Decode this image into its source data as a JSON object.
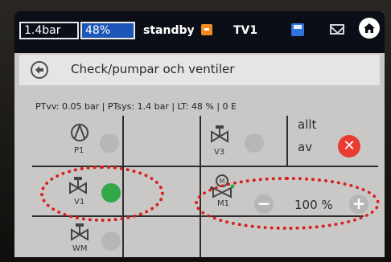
{
  "topbar": {
    "pressure": "1.4bar",
    "percent": "48%",
    "mode": "standby",
    "zone": "TV1"
  },
  "header": {
    "title": "Check/pumpar och ventiler"
  },
  "status_line": "PTvv: 0.05 bar | PTsys: 1.4 bar | LT: 48 % | 0 E",
  "devices": {
    "p1": {
      "label": "P1",
      "state": "off"
    },
    "v1": {
      "label": "V1",
      "state": "on"
    },
    "wm": {
      "label": "WM",
      "state": "off"
    },
    "v3": {
      "label": "V3",
      "state": "off"
    },
    "m1": {
      "label": "M1",
      "value": "100 %"
    }
  },
  "all_off": {
    "line1": "allt",
    "line2": "av"
  },
  "colors": {
    "active": "#33a84a",
    "inactive": "#b7b7b7",
    "close": "#ea3b32",
    "highlight": "#d81e1e",
    "percent_box": "#1e56b8"
  }
}
